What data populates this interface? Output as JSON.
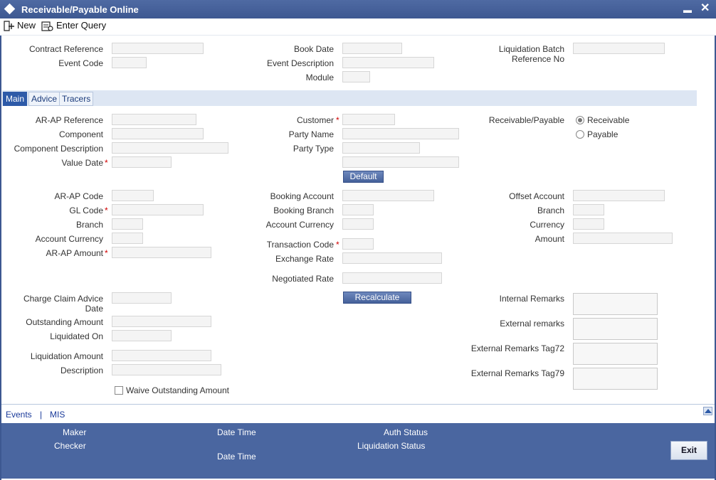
{
  "window": {
    "title": "Receivable/Payable Online",
    "minimize": "▬",
    "close": "✕"
  },
  "toolbar": {
    "new_label": "New",
    "enter_query_label": "Enter Query"
  },
  "header": {
    "contract_reference": "Contract Reference",
    "event_code": "Event Code",
    "book_date": "Book Date",
    "event_description": "Event Description",
    "module": "Module",
    "liquidation_batch": "Liquidation Batch Reference No"
  },
  "tabs": [
    "Main",
    "Advice",
    "Tracers"
  ],
  "main": {
    "arap_reference": "AR-AP Reference",
    "component": "Component",
    "component_description": "Component Description",
    "value_date": "Value Date",
    "customer": "Customer",
    "party_name": "Party Name",
    "party_type": "Party Type",
    "default_button": "Default",
    "receivable_payable": "Receivable/Payable",
    "receivable": "Receivable",
    "payable": "Payable",
    "arap_code": "AR-AP Code",
    "gl_code": "GL Code",
    "branch": "Branch",
    "account_currency": "Account Currency",
    "arap_amount": "AR-AP Amount",
    "booking_account": "Booking Account",
    "booking_branch": "Booking Branch",
    "booking_account_currency": "Account Currency",
    "transaction_code": "Transaction Code",
    "exchange_rate": "Exchange Rate",
    "negotiated_rate": "Negotiated Rate",
    "offset_account": "Offset Account",
    "offset_branch": "Branch",
    "currency": "Currency",
    "amount": "Amount",
    "charge_claim_advice_date": "Charge Claim Advice Date",
    "outstanding_amount": "Outstanding Amount",
    "liquidated_on": "Liquidated On",
    "liquidation_amount": "Liquidation Amount",
    "description": "Description",
    "waive_outstanding": "Waive Outstanding Amount",
    "recalculate_button": "Recalculate",
    "internal_remarks": "Internal Remarks",
    "external_remarks": "External remarks",
    "ext_remarks_tag72": "External Remarks Tag72",
    "ext_remarks_tag79": "External Remarks Tag79",
    "required_mark": "*"
  },
  "subfooter": {
    "events": "Events",
    "separator": "|",
    "mis": "MIS"
  },
  "footer": {
    "maker": "Maker",
    "checker": "Checker",
    "date_time_1": "Date Time",
    "date_time_2": "Date Time",
    "auth_status": "Auth Status",
    "liquidation_status": "Liquidation Status",
    "exit": "Exit"
  }
}
